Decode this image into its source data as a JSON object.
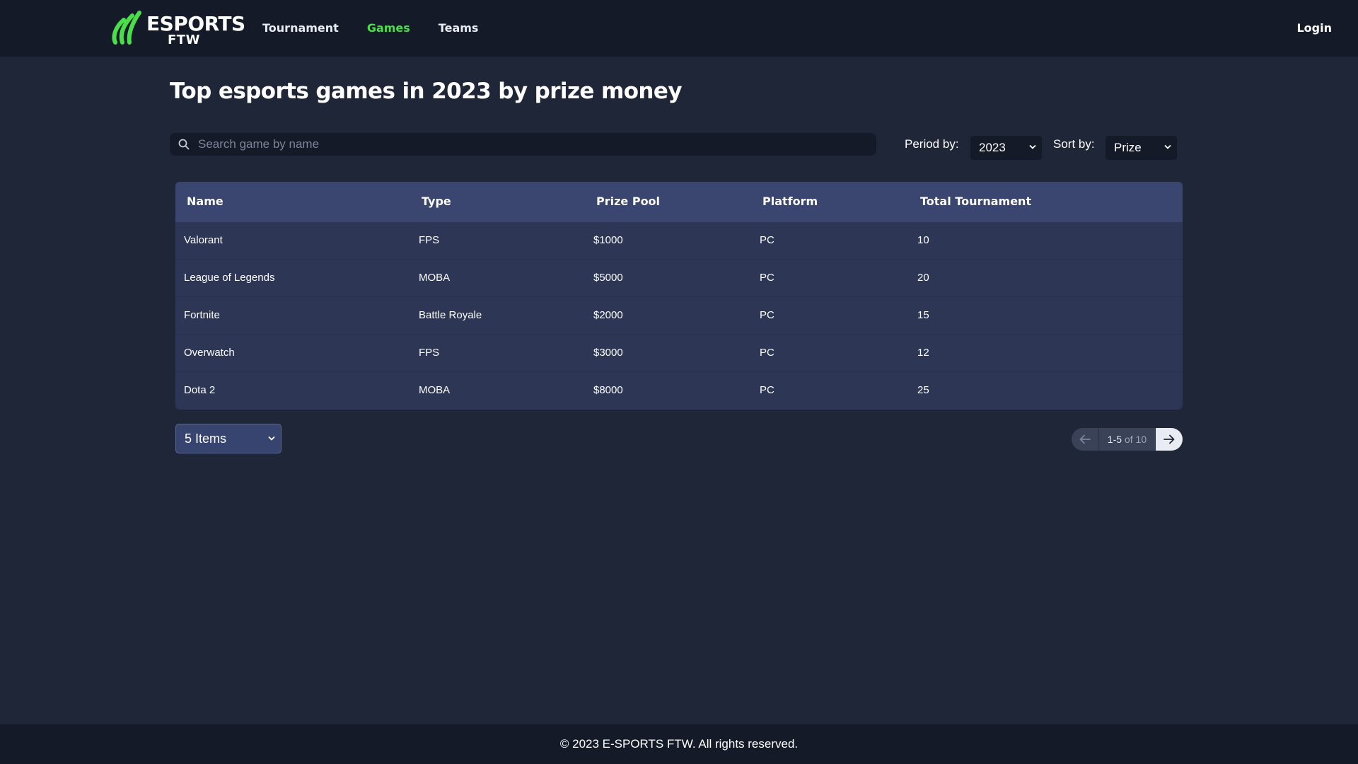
{
  "header": {
    "logo_text": "ESPORTS",
    "logo_subtext": "FTW",
    "nav": [
      {
        "label": "Tournament",
        "active": false
      },
      {
        "label": "Games",
        "active": true
      },
      {
        "label": "Teams",
        "active": false
      }
    ],
    "login_label": "Login",
    "accent_color": "#4ade4a"
  },
  "main": {
    "title": "Top esports games in 2023 by prize money",
    "search": {
      "placeholder": "Search game by name",
      "value": ""
    },
    "filters": {
      "period_label": "Period by:",
      "period_value": "2023",
      "sort_label": "Sort by:",
      "sort_value": "Prize"
    },
    "table": {
      "columns": [
        "Name",
        "Type",
        "Prize Pool",
        "Platform",
        "Total Tournament"
      ],
      "rows": [
        [
          "Valorant",
          "FPS",
          "$1000",
          "PC",
          "10"
        ],
        [
          "League of Legends",
          "MOBA",
          "$5000",
          "PC",
          "20"
        ],
        [
          "Fortnite",
          "Battle Royale",
          "$2000",
          "PC",
          "15"
        ],
        [
          "Overwatch",
          "FPS",
          "$3000",
          "PC",
          "12"
        ],
        [
          "Dota 2",
          "MOBA",
          "$8000",
          "PC",
          "25"
        ]
      ]
    },
    "page_size": "5 Items",
    "pagination": {
      "range": "1-5",
      "of_text": "of 10"
    }
  },
  "footer": {
    "text": "© 2023 E-SPORTS FTW. All rights reserved."
  }
}
